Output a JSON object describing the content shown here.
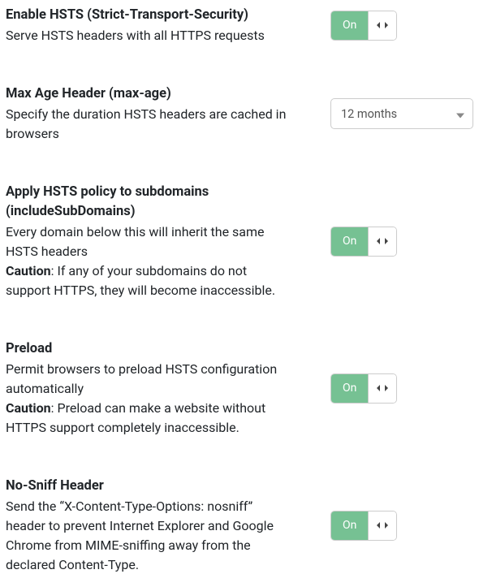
{
  "toggle": {
    "on_label": "On"
  },
  "settings": [
    {
      "title": "Enable HSTS (Strict-Transport-Security)",
      "desc": "Serve HSTS headers with all HTTPS requests",
      "caution_label": "",
      "caution_text": "",
      "control": {
        "type": "toggle",
        "state": "on"
      }
    },
    {
      "title": "Max Age Header (max-age)",
      "desc": "Specify the duration HSTS headers are cached in browsers",
      "caution_label": "",
      "caution_text": "",
      "control": {
        "type": "select",
        "value": "12 months"
      }
    },
    {
      "title": "Apply HSTS policy to subdomains (includeSubDomains)",
      "desc": "Every domain below this will inherit the same HSTS headers",
      "caution_label": "Caution",
      "caution_text": ": If any of your subdomains do not support HTTPS, they will become inaccessible.",
      "control": {
        "type": "toggle",
        "state": "on"
      }
    },
    {
      "title": "Preload",
      "desc": "Permit browsers to preload HSTS configuration automatically",
      "caution_label": "Caution",
      "caution_text": ": Preload can make a website without HTTPS support completely inaccessible.",
      "control": {
        "type": "toggle",
        "state": "on"
      }
    },
    {
      "title": "No-Sniff Header",
      "desc": "Send the “X-Content-Type-Options: nosniff” header to prevent Internet Explorer and Google Chrome from MIME-sniffing away from the declared Content-Type.",
      "caution_label": "",
      "caution_text": "",
      "control": {
        "type": "toggle",
        "state": "on"
      }
    }
  ]
}
